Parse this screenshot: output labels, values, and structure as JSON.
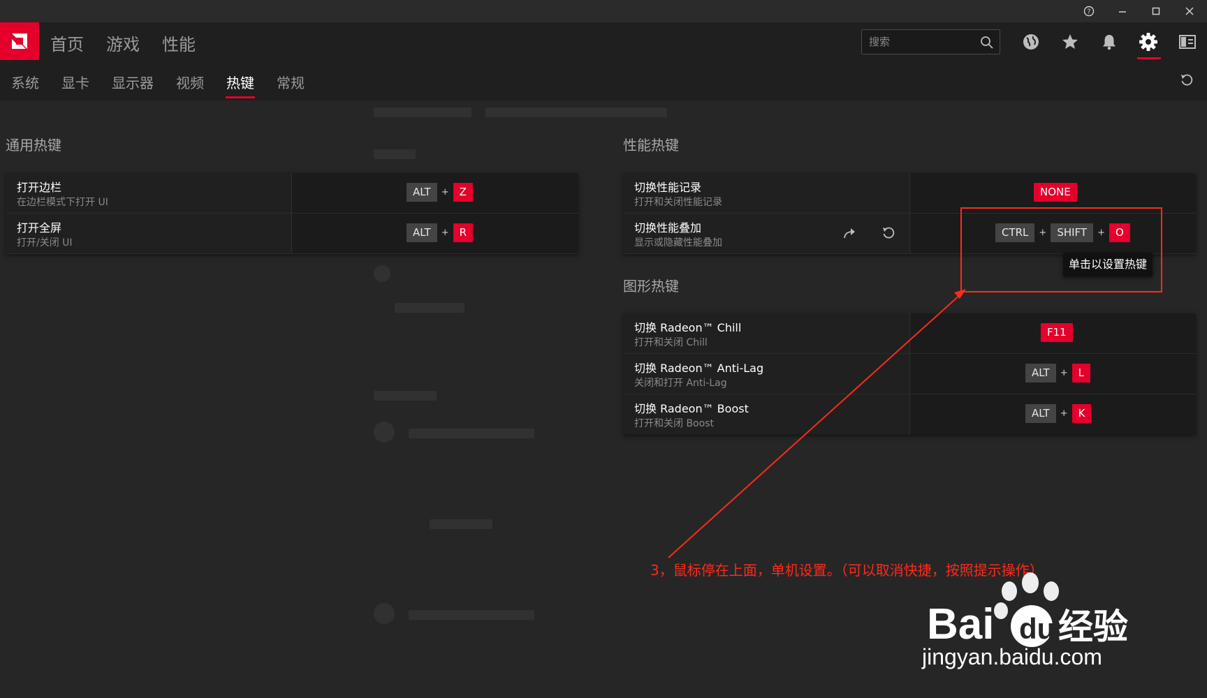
{
  "colors": {
    "accent": "#e4002b",
    "annotation": "#ff2a1a",
    "background": "#262626"
  },
  "window": {
    "help_icon": "help-circle-icon",
    "minimize_icon": "minimize-icon",
    "maximize_icon": "maximize-icon",
    "close_icon": "close-icon"
  },
  "topnav": {
    "items": [
      {
        "label": "首页"
      },
      {
        "label": "游戏"
      },
      {
        "label": "性能"
      }
    ],
    "search": {
      "placeholder": "搜索"
    },
    "icons": [
      "globe-icon",
      "star-icon",
      "bell-icon",
      "gear-icon",
      "sidebar-icon"
    ],
    "active_icon": "gear-icon"
  },
  "subnav": {
    "items": [
      {
        "label": "系统"
      },
      {
        "label": "显卡"
      },
      {
        "label": "显示器"
      },
      {
        "label": "视频"
      },
      {
        "label": "热键"
      },
      {
        "label": "常规"
      }
    ],
    "active": "热键"
  },
  "general": {
    "title": "通用热键",
    "rows": [
      {
        "name": "打开边栏",
        "desc": "在边栏模式下打开 UI",
        "keys": [
          "ALT",
          "Z"
        ]
      },
      {
        "name": "打开全屏",
        "desc": "打开/关闭 UI",
        "keys": [
          "ALT",
          "R"
        ]
      }
    ]
  },
  "performance": {
    "title": "性能热键",
    "rows": [
      {
        "name": "切换性能记录",
        "desc": "打开和关闭性能记录",
        "keys": [
          "NONE"
        ]
      },
      {
        "name": "切换性能叠加",
        "desc": "显示或隐藏性能叠加",
        "keys": [
          "CTRL",
          "SHIFT",
          "O"
        ]
      }
    ],
    "tooltip": "单击以设置热键"
  },
  "graphics": {
    "title": "图形热键",
    "rows": [
      {
        "name": "切换 Radeon™ Chill",
        "desc": "打开和关闭 Chill",
        "keys": [
          "F11"
        ]
      },
      {
        "name": "切换 Radeon™ Anti-Lag",
        "desc": "关闭和打开 Anti-Lag",
        "keys": [
          "ALT",
          "L"
        ]
      },
      {
        "name": "切换 Radeon™ Boost",
        "desc": "打开和关闭 Boost",
        "keys": [
          "ALT",
          "K"
        ]
      }
    ]
  },
  "annotation": {
    "text": "3，鼠标停在上面，单机设置。（可以取消快捷，按照提示操作）"
  },
  "watermark": {
    "brand": "Bai经验",
    "url": "jingyan.baidu.com"
  }
}
